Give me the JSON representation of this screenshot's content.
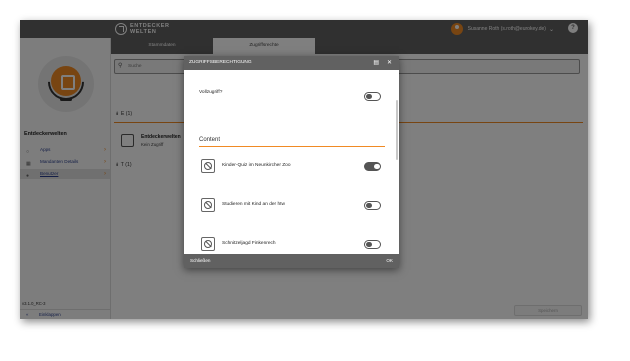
{
  "topbar": {
    "logo_line1": "ENTDECKER",
    "logo_line2": "WELTEN",
    "user_name": "Susanne Roth (s.roth@eurokey.de)",
    "help_label": "?"
  },
  "tabs": [
    {
      "label": "Stammdaten"
    },
    {
      "label": "Zugriffsrechte"
    }
  ],
  "sidebar": {
    "title": "Entdeckerwelten",
    "items": [
      {
        "label": "Apps"
      },
      {
        "label": "Mandanten Details"
      },
      {
        "label": "Benutzer"
      }
    ],
    "version": "v3.1.0_RC-3",
    "collapse_label": "Einklappen"
  },
  "main": {
    "search_placeholder": "Suche",
    "groups": [
      {
        "label": "E (1)"
      },
      {
        "label": "T (1)"
      }
    ],
    "entry": {
      "name": "Entdeckerwelten",
      "status": "Kein Zugriff"
    },
    "save_label": "Speichern"
  },
  "dialog": {
    "title": "ZUGRIFFSBERECHTIGUNG",
    "full_access_label": "Vollzugriff?",
    "full_access_on": false,
    "section_label": "Content",
    "items": [
      {
        "label": "Kinder-Quiz im Neunkircher Zoo",
        "on": true
      },
      {
        "label": "Studieren mit Kind an der htw",
        "on": false
      },
      {
        "label": "Schnitzeljagd Finkenrech",
        "on": false
      }
    ],
    "close_label": "Schließen",
    "ok_label": "OK"
  },
  "colors": {
    "accent": "#f08a24",
    "bar": "#616161",
    "link": "#2a3f8f"
  }
}
